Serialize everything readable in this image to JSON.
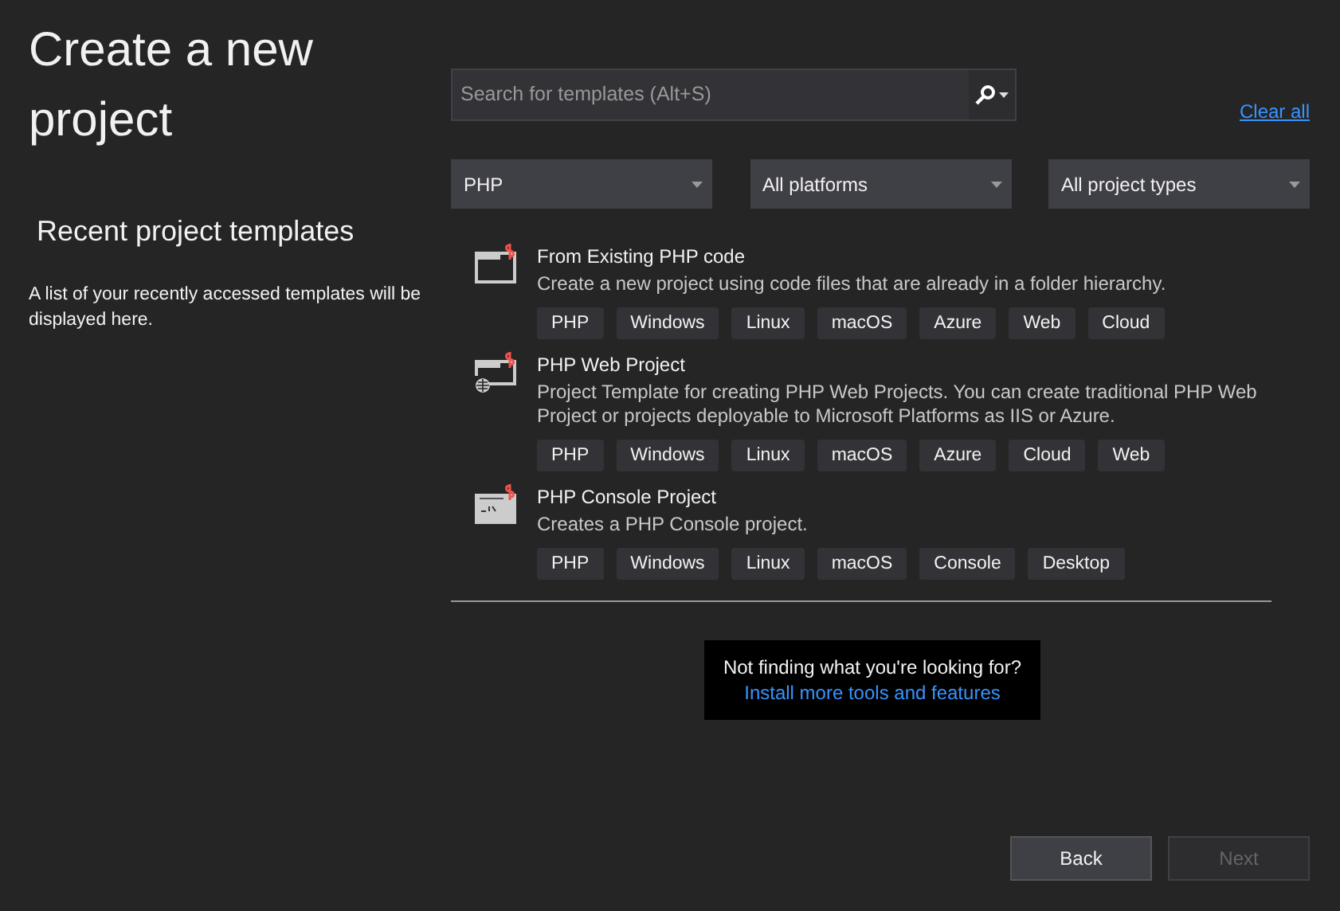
{
  "title": "Create a new project",
  "recent": {
    "heading": "Recent project templates",
    "message": "A list of your recently accessed templates will be displayed here."
  },
  "search": {
    "placeholder": "Search for templates (Alt+S)"
  },
  "clear_all": "Clear all",
  "filters": [
    {
      "value": "PHP"
    },
    {
      "value": "All platforms"
    },
    {
      "value": "All project types"
    }
  ],
  "templates": [
    {
      "kind": "window",
      "name": "From Existing PHP code",
      "description": "Create a new project using code files that are already in a folder hierarchy.",
      "tags": [
        "PHP",
        "Windows",
        "Linux",
        "macOS",
        "Azure",
        "Web",
        "Cloud"
      ]
    },
    {
      "kind": "web",
      "name": "PHP Web Project",
      "description": "Project Template for creating PHP Web Projects. You can create traditional PHP Web Project or projects deployable to Microsoft Platforms as IIS or Azure.",
      "tags": [
        "PHP",
        "Windows",
        "Linux",
        "macOS",
        "Azure",
        "Cloud",
        "Web"
      ]
    },
    {
      "kind": "console",
      "name": "PHP Console Project",
      "description": "Creates a PHP Console project.",
      "tags": [
        "PHP",
        "Windows",
        "Linux",
        "macOS",
        "Console",
        "Desktop"
      ]
    }
  ],
  "not_finding": {
    "message": "Not finding what you're looking for?",
    "link": "Install more tools and features"
  },
  "buttons": [
    {
      "label": "Back",
      "disabled": false
    },
    {
      "label": "Next",
      "disabled": true
    }
  ]
}
